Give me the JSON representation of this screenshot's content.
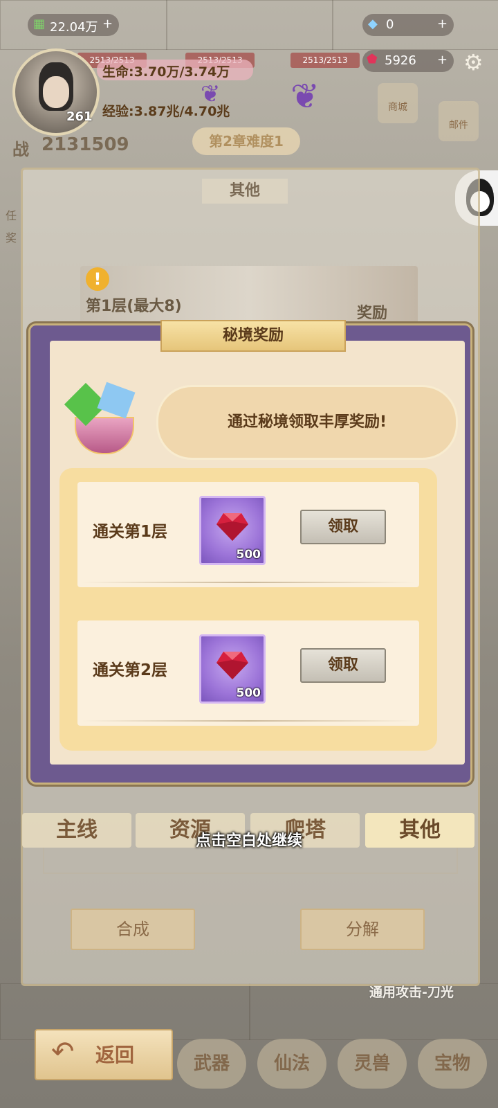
{
  "hud": {
    "currency_value": "22.04万",
    "diamond_value": "0",
    "ruby_value": "5926",
    "hp_label": "生命:3.70万/3.74万",
    "exp_label": "经验:3.87兆/4.70兆",
    "level": "261",
    "power_label": "战",
    "power_value": "2131509",
    "chapter_label": "第2章难度1",
    "enemy_hp": [
      "2513/2513",
      "2513/2513",
      "2513/2513"
    ],
    "shop_label": "商城",
    "mail_label": "邮件"
  },
  "panel": {
    "title": "其他",
    "floor_banner": "第1层(最大8)",
    "reward_label": "奖励",
    "tabs": [
      "主线",
      "资源",
      "爬塔",
      "其他"
    ],
    "compose_label": "合成",
    "decompose_label": "分解",
    "skill_label": "通用攻击-刀光"
  },
  "dialog": {
    "title": "秘境奖励",
    "message": "通过秘境领取丰厚奖励!",
    "rows": [
      {
        "label": "通关第1层",
        "qty": "500",
        "button": "领取"
      },
      {
        "label": "通关第2层",
        "qty": "500",
        "button": "领取"
      }
    ]
  },
  "continue_hint": "点击空白处继续",
  "bottom": {
    "back_label": "返回",
    "nav": [
      "武器",
      "仙法",
      "灵兽",
      "宝物"
    ]
  },
  "colors": {
    "dialog_frame": "#6d5a8f",
    "dialog_bg": "#f3e4cc",
    "list_bg": "#f7dda0",
    "item_purple": "#9c74d8"
  }
}
